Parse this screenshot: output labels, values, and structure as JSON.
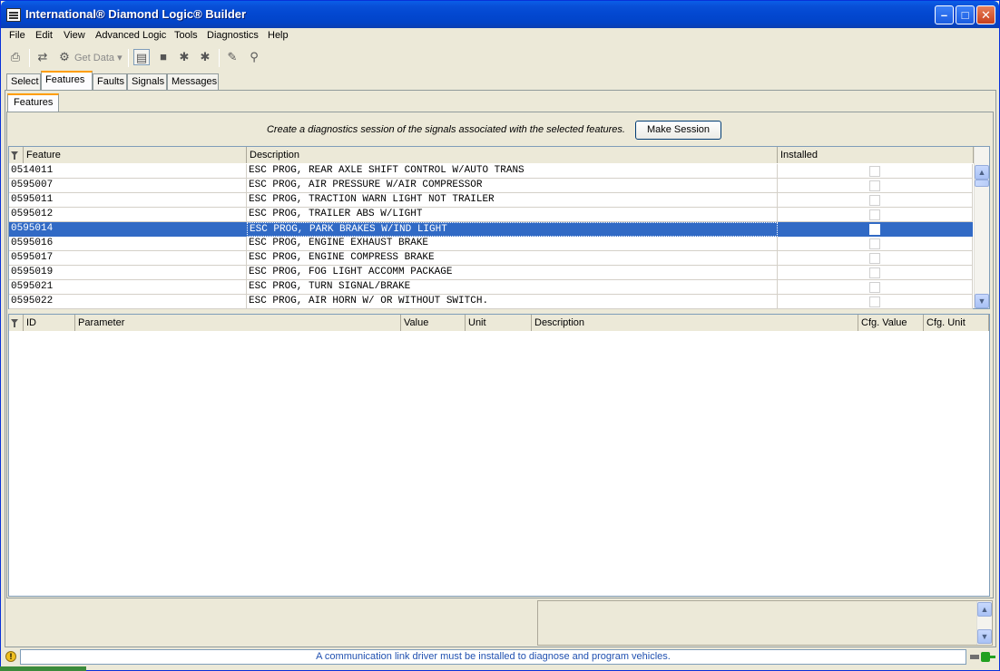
{
  "window": {
    "title": "International® Diamond Logic® Builder"
  },
  "menu": [
    "File",
    "Edit",
    "View",
    "Advanced Logic",
    "Tools",
    "Diagnostics",
    "Help"
  ],
  "toolbar": {
    "get_data_label": "Get Data",
    "icons": [
      "print-icon",
      "connect-icon",
      "get-data-icon",
      "document-icon",
      "stop-icon",
      "bug-icon",
      "bug-alt-icon",
      "eraser-icon",
      "key-icon"
    ]
  },
  "tabs": [
    "Select",
    "Features",
    "Faults",
    "Signals",
    "Messages"
  ],
  "active_tab": "Features",
  "subtab": "Features",
  "session": {
    "prompt": "Create a diagnostics session of the signals associated with the selected features.",
    "button": "Make Session"
  },
  "features_table": {
    "columns": [
      "Feature",
      "Description",
      "Installed"
    ],
    "rows": [
      {
        "feature": "0514011",
        "description": "ESC PROG, REAR AXLE SHIFT CONTROL W/AUTO TRANS",
        "installed": false
      },
      {
        "feature": "0595007",
        "description": "ESC PROG, AIR PRESSURE W/AIR COMPRESSOR",
        "installed": false
      },
      {
        "feature": "0595011",
        "description": "ESC PROG, TRACTION WARN LIGHT NOT TRAILER",
        "installed": false
      },
      {
        "feature": "0595012",
        "description": "ESC PROG, TRAILER ABS W/LIGHT",
        "installed": false
      },
      {
        "feature": "0595014",
        "description": "ESC PROG, PARK BRAKES W/IND LIGHT",
        "installed": false,
        "selected": true
      },
      {
        "feature": "0595016",
        "description": "ESC PROG, ENGINE EXHAUST BRAKE",
        "installed": false
      },
      {
        "feature": "0595017",
        "description": "ESC PROG, ENGINE COMPRESS BRAKE",
        "installed": false
      },
      {
        "feature": "0595019",
        "description": "ESC PROG, FOG LIGHT ACCOMM PACKAGE",
        "installed": false
      },
      {
        "feature": "0595021",
        "description": "ESC PROG, TURN SIGNAL/BRAKE",
        "installed": false
      },
      {
        "feature": "0595022",
        "description": "ESC PROG, AIR HORN W/ OR WITHOUT SWITCH.",
        "installed": false
      }
    ]
  },
  "signals_table": {
    "columns": [
      "ID",
      "Parameter",
      "Value",
      "Unit",
      "Description",
      "Cfg. Value",
      "Cfg. Unit"
    ]
  },
  "status": {
    "message": "A communication link driver must be installed to diagnose and program vehicles."
  },
  "colors": {
    "selection": "#316AC5",
    "titlebar": "#0348D1",
    "face": "#ECE9D8"
  }
}
